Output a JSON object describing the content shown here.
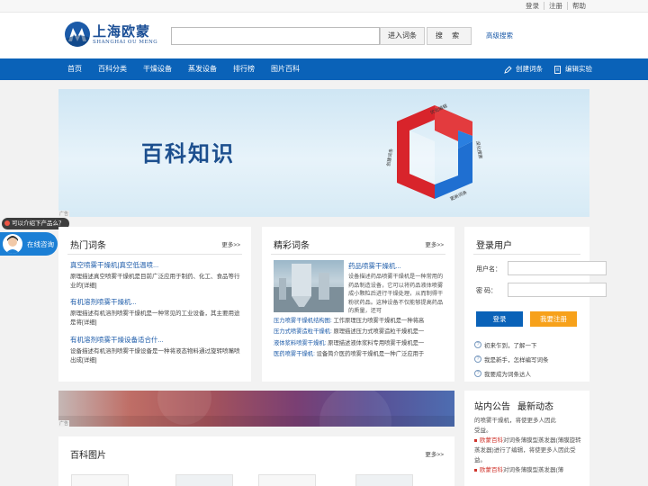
{
  "top": {
    "links": [
      "登录",
      "注册",
      "帮助"
    ]
  },
  "header": {
    "logo_cn": "上海欧蒙",
    "logo_en": "SHANGHAI OU MENG",
    "search_placeholder": "",
    "enter_button": "进入词条",
    "search_button": "搜 索",
    "advanced_search": "高级搜索"
  },
  "nav": {
    "items": [
      "首页",
      "百科分类",
      "干燥设备",
      "蒸发设备",
      "排行榜",
      "图片百科"
    ],
    "create_entry": "创建词条",
    "edit_lab": "编辑实验"
  },
  "banner": {
    "title": "百科知识",
    "cube_labels": [
      "优化编辑",
      "深化搜索",
      "更新词条",
      "创建词条"
    ]
  },
  "float": {
    "tip": "可以介绍下产品么？",
    "consult": "在线咨询",
    "ad_tag": "广告"
  },
  "hot": {
    "title": "热门词条",
    "more": "更多>>",
    "items": [
      {
        "title": "真空喷雾干燥机|真空低温喷...",
        "desc": "原理描述真空喷雾干燥机是目前广泛应用于制药、化工、食品等行业的[详细]"
      },
      {
        "title": "有机溶剂喷雾干燥机...",
        "desc": "原理描述有机溶剂喷雾干燥机是一种常见的工业设备，其主要用途是将[详细]"
      },
      {
        "title": "有机溶剂喷雾干燥设备适合什...",
        "desc": "设备描述有机溶剂喷雾干燥设备是一种将液态物料通过旋转喷嘴喷出成[详细]"
      }
    ]
  },
  "featured": {
    "title": "精彩词条",
    "more": "更多>>",
    "lead_title": "药品喷雾干燥机...",
    "lead_desc": "设备描述药品喷雾干燥机是一种常用的药品制造设备，它可以将药品液体喷雾成小颗粒后进行干燥处理，从而制得干粉状药品。这种设备不仅能够提高药品的质量，还可",
    "list": [
      {
        "k": "压力喷雾干燥机结构图:",
        "v": " 工作原理压力喷雾干燥机是一种将高"
      },
      {
        "k": "压力式喷雾造粒干燥机:",
        "v": " 原理描述压力式喷雾造粒干燥机是一"
      },
      {
        "k": "液体浆料喷雾干燥机:",
        "v": " 原理描述液体浆料专用喷雾干燥机是一"
      },
      {
        "k": "医药喷雾干燥机:",
        "v": " 设备简介医药喷雾干燥机是一种广泛应用于"
      }
    ]
  },
  "login": {
    "title": "登录用户",
    "username_label": "用户名：",
    "password_label": "密  码：",
    "login_button": "登录",
    "register_button": "我要注册",
    "help": [
      "初来乍到，了解一下",
      "我是新手，怎样编写词条",
      "我要成为词条达人"
    ]
  },
  "notice": {
    "tabs": [
      "站内公告",
      "最新动态"
    ],
    "lines_top": [
      "的喷雾干燥机，将使更多人因此",
      "受益。"
    ],
    "entries": [
      {
        "k": "欧蒙百科",
        "v": "对词条薄膜型蒸发器(薄膜旋转蒸发器)进行了编辑，将使更多人因此受益。"
      },
      {
        "k": "欧蒙百科",
        "v": "对词条薄膜型蒸发器(薄"
      }
    ]
  },
  "pics": {
    "title": "百科图片",
    "more": "更多>>"
  },
  "colors": {
    "brand": "#0a62b8",
    "link": "#1b5aa8",
    "register": "#f7a11a",
    "accent_red": "#d0342c"
  }
}
